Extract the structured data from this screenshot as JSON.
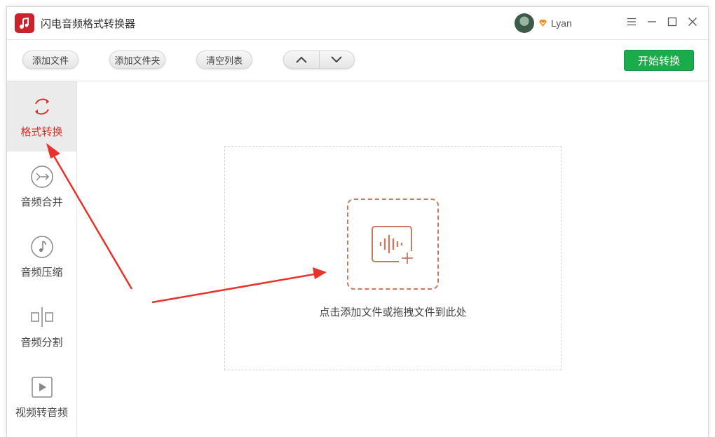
{
  "app": {
    "title": "闪电音频格式转换器",
    "brand_color": "#c8232a"
  },
  "user": {
    "name": "Lyan",
    "vip_color": "#f08c1e"
  },
  "window_controls": {
    "menu": "menu-icon",
    "minimize": "minimize-icon",
    "maximize": "maximize-icon",
    "close": "close-icon"
  },
  "toolbar": {
    "add_file": "添加文件",
    "add_folder": "添加文件夹",
    "clear_list": "清空列表",
    "move_up": "chevron-up-icon",
    "move_down": "chevron-down-icon",
    "start": "开始转换",
    "start_color": "#1aab4a"
  },
  "sidebar": {
    "items": [
      {
        "label": "格式转换",
        "icon": "refresh-convert-icon",
        "active": true
      },
      {
        "label": "音频合并",
        "icon": "merge-icon",
        "active": false
      },
      {
        "label": "音频压缩",
        "icon": "music-note-icon",
        "active": false
      },
      {
        "label": "音频分割",
        "icon": "split-icon",
        "active": false
      },
      {
        "label": "视频转音频",
        "icon": "video-play-icon",
        "active": false
      }
    ],
    "active_color": "#d9302a"
  },
  "main": {
    "drop_hint": "点击添加文件或拖拽文件到此处",
    "add_icon": "audio-add-icon",
    "accent_color": "#c77b62"
  },
  "annotations": {
    "arrow_color": "#e8322a"
  }
}
